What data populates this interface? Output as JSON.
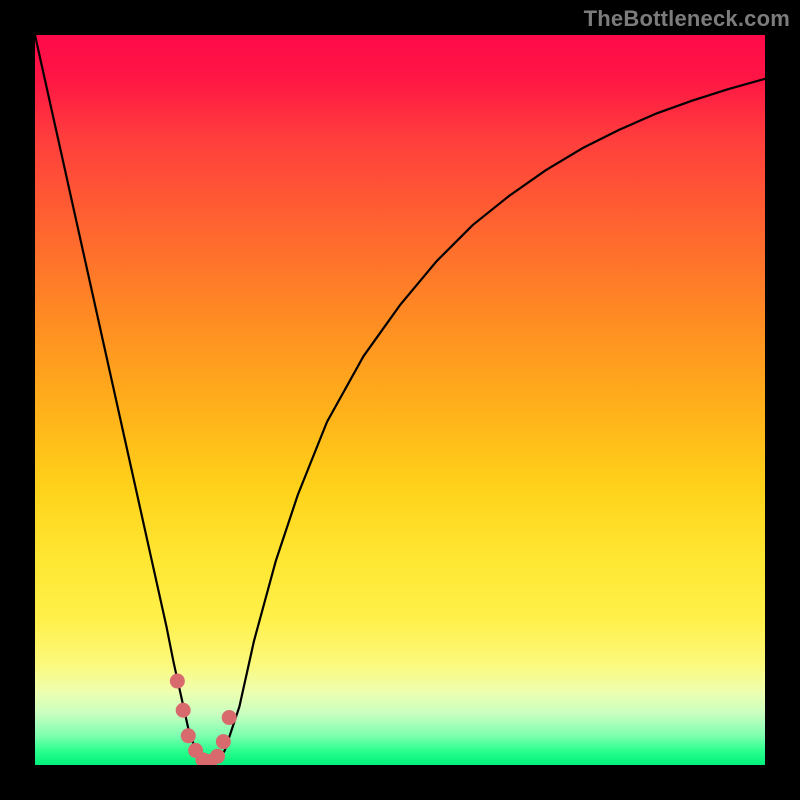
{
  "watermark": "TheBottleneck.com",
  "colors": {
    "frame": "#000000",
    "curve": "#000000",
    "marker": "#d86a6e",
    "gradient_top": "#ff0a4a",
    "gradient_bottom": "#00f07a"
  },
  "chart_data": {
    "type": "line",
    "title": "",
    "xlabel": "",
    "ylabel": "",
    "xlim": [
      0,
      100
    ],
    "ylim": [
      0,
      100
    ],
    "x": [
      0,
      2,
      4,
      6,
      8,
      10,
      12,
      14,
      16,
      18,
      19,
      20,
      21,
      22,
      23,
      24,
      25,
      26,
      28,
      30,
      33,
      36,
      40,
      45,
      50,
      55,
      60,
      65,
      70,
      75,
      80,
      85,
      90,
      95,
      100
    ],
    "values": [
      100,
      91,
      82,
      73,
      64,
      55,
      46,
      37,
      28,
      19,
      14,
      9.5,
      5,
      2,
      0.5,
      0,
      0.5,
      2,
      8,
      17,
      28,
      37,
      47,
      56,
      63,
      69,
      74,
      78,
      81.5,
      84.5,
      87,
      89.2,
      91,
      92.6,
      94
    ],
    "markers_x": [
      19.5,
      20.3,
      21.0,
      22.0,
      23.0,
      24.0,
      25.0,
      25.8,
      26.6
    ],
    "markers_y": [
      11.5,
      7.5,
      4.0,
      2.0,
      0.7,
      0.5,
      1.2,
      3.2,
      6.5
    ]
  }
}
